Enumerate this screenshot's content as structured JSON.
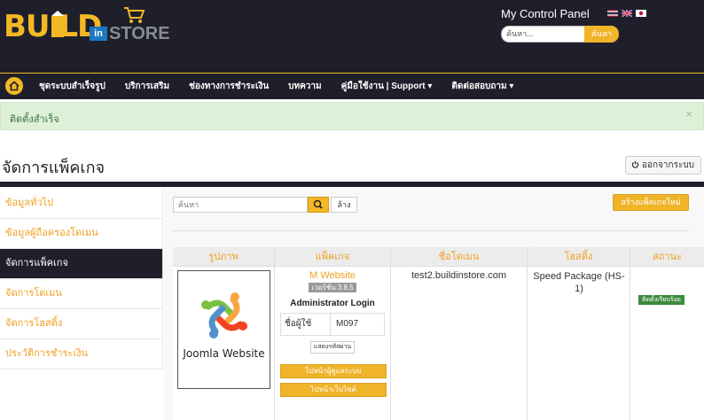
{
  "header": {
    "logo_build": "BU  LD",
    "logo_in": "in",
    "logo_store": "STORE",
    "panel_title": "My Control Panel",
    "search_placeholder": "ค้นหา...",
    "search_button": "ค้นหา",
    "flags": [
      "thai-flag",
      "uk-flag",
      "japan-flag"
    ]
  },
  "nav": {
    "items": [
      {
        "label": "ชุดระบบสำเร็จรูป"
      },
      {
        "label": "บริการเสริม"
      },
      {
        "label": "ช่องทางการชำระเงิน"
      },
      {
        "label": "บทความ"
      },
      {
        "label": "คู่มือใช้งาน | Support ▾"
      },
      {
        "label": "ติดต่อสอบถาม ▾"
      }
    ]
  },
  "alert": {
    "message": "ติดตั้งสำเร็จ",
    "close": "×"
  },
  "page": {
    "title": "จัดการแพ็คเกจ",
    "logout": "ออกจากระบบ"
  },
  "sidebar": {
    "items": [
      {
        "label": "ข้อมูลทั่วไป"
      },
      {
        "label": "ข้อมูลผู้ถือครองโดเมน"
      },
      {
        "label": "จัดการแพ็คเกจ"
      },
      {
        "label": "จัดการโดเมน"
      },
      {
        "label": "จัดการโฮสติ้ง"
      },
      {
        "label": "ประวัติการชำระเงิน"
      }
    ]
  },
  "toolbar": {
    "search_placeholder": "ค้นหา",
    "clear_label": "ล้าง",
    "create_label": "สร้างแพ็คเกจใหม่"
  },
  "table": {
    "headers": [
      "รูปภาพ",
      "แพ็คเกจ",
      "ชื่อโดเมน",
      "โฮสติ้ง",
      "สถานะ"
    ],
    "rows": [
      {
        "image_caption": "Joomla Website",
        "package_name": "M Website",
        "version": "เวอร์ชั่น 3.8.5",
        "admin_login": "Administrator Login",
        "username_label": "ชื่อผู้ใช้",
        "username_value": "M097",
        "show_password": "แสดงรหัสผ่าน",
        "btn_backend": "ไปหน้าผู้ดูแลระบบ",
        "btn_frontend": "ไปหน้าเว็บไซต์",
        "domain": "test2.buildinstore.com",
        "hosting": "Speed Package (HS-1)",
        "status": "ติดตั้งเรียบร้อย"
      }
    ]
  },
  "colors": {
    "accent": "#f0b429",
    "dark": "#1e1f2b",
    "success_bg": "#dff0d8",
    "status_green": "#3c8a3c"
  }
}
